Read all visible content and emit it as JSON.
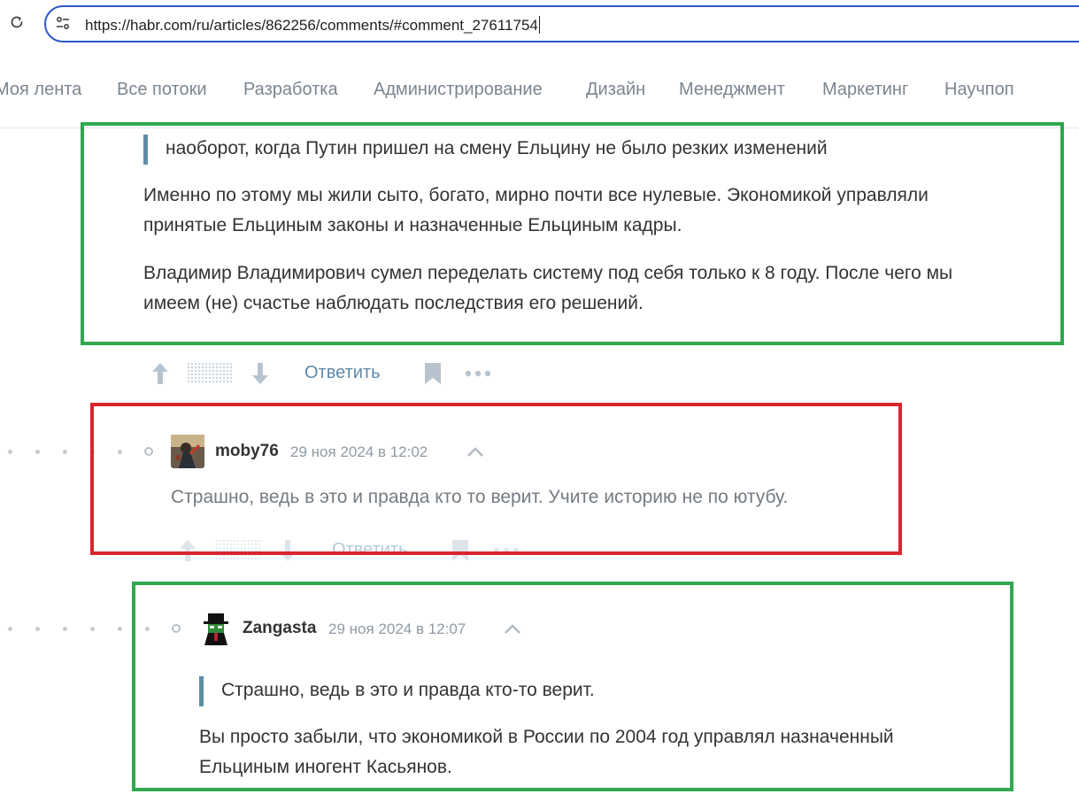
{
  "browser": {
    "url": "https://habr.com/ru/articles/862256/comments/#comment_27611754"
  },
  "nav": {
    "items": [
      "Моя лента",
      "Все потоки",
      "Разработка",
      "Администрирование",
      "Дизайн",
      "Менеджмент",
      "Маркетинг",
      "Научпоп"
    ]
  },
  "comments": [
    {
      "quote": "наоборот, когда Путин пришел на смену Ельцину не было резких изменений",
      "paragraphs": [
        [
          "Именно по этому мы жили сыто, богато, мирно почти все нулевые. Экономикой управляли",
          "принятые Ельциным законы и назначенные Ельциным кадры."
        ],
        [
          "Владимир Владимирович сумел переделать систему под себя только к 8 году. После чего мы",
          "имеем (не) счастье наблюдать последствия его решений."
        ]
      ],
      "reply_label": "Ответить"
    },
    {
      "user": "moby76",
      "date": "29 ноя 2024 в 12:02",
      "text": "Страшно, ведь в это и правда кто то верит. Учите историю не по ютубу.",
      "reply_label": "Ответить"
    },
    {
      "user": "Zangasta",
      "date": "29 ноя 2024 в 12:07",
      "quote": "Страшно, ведь в это и правда кто-то верит.",
      "lines": [
        "Вы просто забыли, что экономикой в России по 2004 год управлял назначенный",
        "Ельциным иногент Касьянов."
      ]
    }
  ],
  "colors": {
    "highlight_green": "#2fa84f",
    "highlight_red": "#d9262e",
    "link": "#5e8aa8",
    "nav_text": "#7b8590"
  },
  "icons": [
    "reload-icon",
    "site-info-icon",
    "vote-up-icon",
    "vote-down-icon",
    "bookmark-icon",
    "more-icon",
    "collapse-icon"
  ]
}
